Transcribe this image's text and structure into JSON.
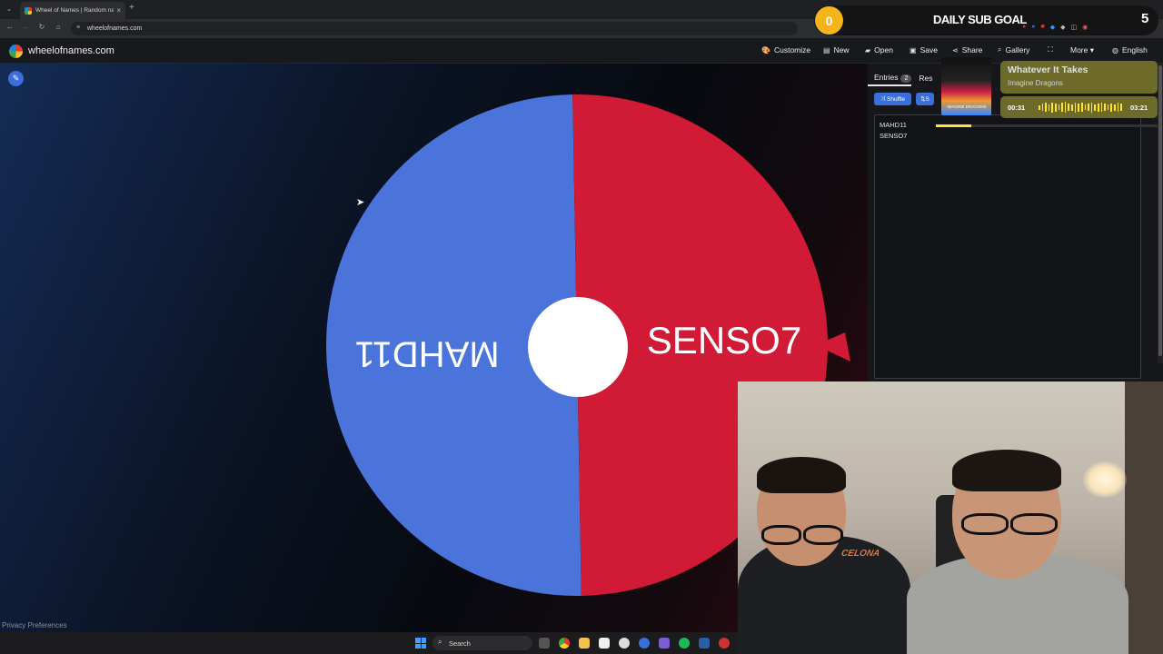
{
  "browser": {
    "tab_title": "Wheel of Names | Random nam",
    "tab_close": "×",
    "new_tab": "+",
    "url": "wheelofnames.com"
  },
  "site": {
    "name": "wheelofnames.com",
    "menu": [
      {
        "label": "Customize",
        "icon": "palette-icon",
        "glyph": "🎨"
      },
      {
        "label": "New",
        "icon": "new-file-icon",
        "glyph": "▤"
      },
      {
        "label": "Open",
        "icon": "folder-icon",
        "glyph": "▰"
      },
      {
        "label": "Save",
        "icon": "save-icon",
        "glyph": "▣"
      },
      {
        "label": "Share",
        "icon": "share-icon",
        "glyph": "⋖"
      },
      {
        "label": "Gallery",
        "icon": "search-icon",
        "glyph": "⌕"
      },
      {
        "label": "",
        "icon": "fullscreen-icon",
        "glyph": "⛶"
      },
      {
        "label": "More ▾",
        "icon": "",
        "glyph": ""
      },
      {
        "label": "English",
        "icon": "globe-icon",
        "glyph": "◍"
      }
    ]
  },
  "wheel": {
    "segments": [
      {
        "label": "MAHD11",
        "color": "#4a74d9"
      },
      {
        "label": "SENSO7",
        "color": "#d11a36"
      }
    ],
    "center_color": "#ffffff",
    "pointer_color": "#d11a36"
  },
  "panel": {
    "tab_entries": "Entries",
    "entries_count": "2",
    "tab_results": "Res",
    "shuffle_label": "Shuffle",
    "sort_label": "S",
    "entries": [
      "MAHD11",
      "SENSO7"
    ]
  },
  "privacy": "Privacy Preferences",
  "overlay": {
    "sub_count": "0",
    "goal_label": "DAILY SUB GOAL",
    "goal_target": "5",
    "song_title": "Whatever It Takes",
    "artist": "Imagine Dragons",
    "album_band": "IMAGINE DRAGONS",
    "time_elapsed": "00:31",
    "time_total": "03:21",
    "progress": 0.16
  },
  "webcam": {
    "shirt_text": "CELONA"
  },
  "taskbar": {
    "search_label": "Search"
  },
  "colors": {
    "accent": "#3b6fd9",
    "brand_yellow": "#f4b41a",
    "now_playing_bg": "#6e6a2a",
    "eq_yellow": "#ffe23a"
  }
}
